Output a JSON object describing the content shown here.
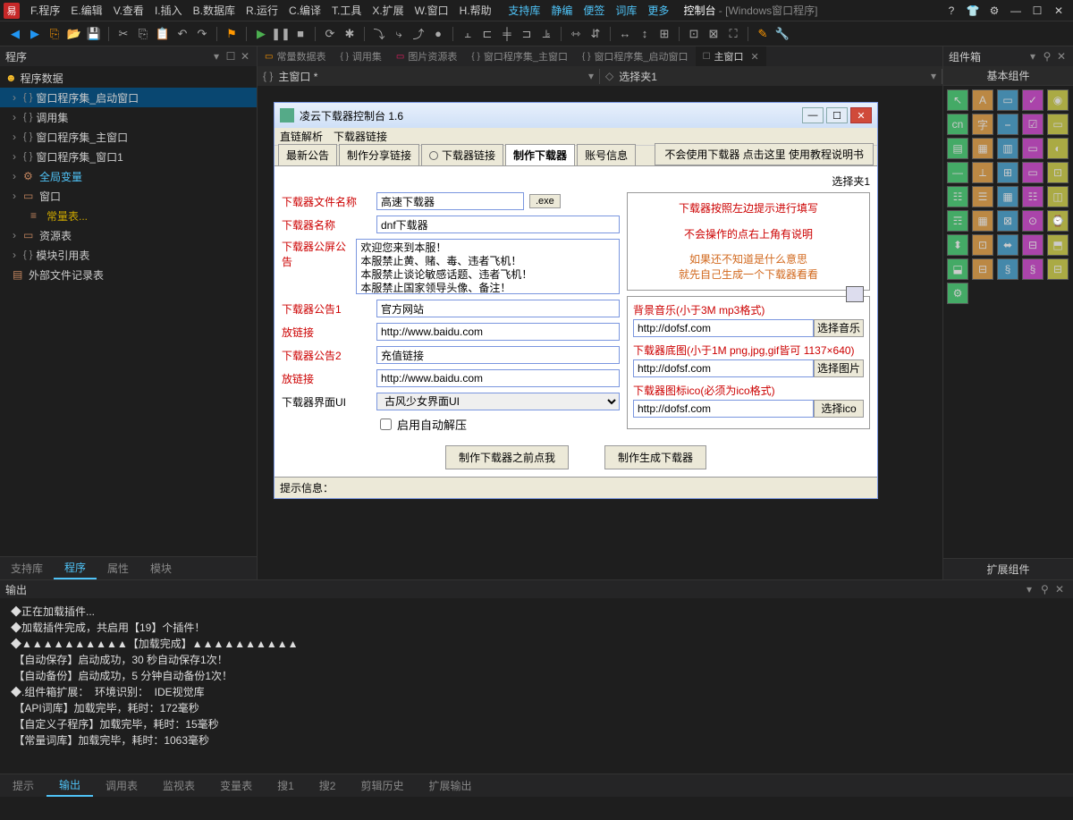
{
  "menubar": {
    "logo": "易",
    "items": [
      "F.程序",
      "E.编辑",
      "V.查看",
      "I.插入",
      "B.数据库",
      "R.运行",
      "C.编译",
      "T.工具",
      "X.扩展",
      "W.窗口",
      "H.帮助"
    ],
    "ext_items": [
      "支持库",
      "静编",
      "便签",
      "词库",
      "更多"
    ],
    "title_main": "控制台",
    "title_sub": " - [Windows窗口程序]"
  },
  "left": {
    "panel_label": "程序",
    "root": "程序数据",
    "items": [
      {
        "label": "窗口程序集_启动窗口",
        "sel": true
      },
      {
        "label": "调用集"
      },
      {
        "label": "窗口程序集_主窗口"
      },
      {
        "label": "窗口程序集_窗口1"
      },
      {
        "label": "全局变量",
        "blue": true,
        "icon": "⚙"
      },
      {
        "label": "窗口",
        "folder": true
      },
      {
        "label": "常量表...",
        "yellow": true,
        "indent": true,
        "icon": "≡"
      },
      {
        "label": "资源表",
        "folder": true,
        "icon": "▦"
      },
      {
        "label": "模块引用表",
        "br": true
      },
      {
        "label": "外部文件记录表",
        "leaf": true,
        "icon": "▤"
      }
    ],
    "tabs": [
      "支持库",
      "程序",
      "属性",
      "模块"
    ],
    "active_tab": 1
  },
  "doc_tabs": [
    {
      "label": "常量数据表",
      "icon": "orange"
    },
    {
      "label": "调用集",
      "icon": "grey"
    },
    {
      "label": "图片资源表",
      "icon": "pink"
    },
    {
      "label": "窗口程序集_主窗口",
      "icon": "grey"
    },
    {
      "label": "窗口程序集_启动窗口",
      "icon": "grey"
    },
    {
      "label": "主窗口",
      "icon": "grey",
      "active": true,
      "close": true
    }
  ],
  "subbar": {
    "left": "主窗口 *",
    "right": "选择夹1"
  },
  "sim": {
    "title": "凌云下载器控制台  1.6",
    "menu": [
      "直链解析",
      "下载器链接"
    ],
    "tabs": [
      "最新公告",
      "制作分享链接",
      "下载器链接",
      "制作下载器",
      "账号信息"
    ],
    "tab_dot_index": 2,
    "active_tab": 3,
    "right_note": "不会使用下载器 点击这里 使用教程说明书",
    "clip_label": "选择夹1",
    "f": {
      "file_label": "下载器文件名称",
      "file_val": "高速下载器",
      "file_ext": ".exe",
      "name_label": "下载器名称",
      "name_val": "dnf下载器",
      "ann_label": "下载器公屏公告",
      "ann_val": "欢迎您来到本服！\n本服禁止黄、赌、毒、违者飞机！\n本服禁止谈论敏感话题、违者飞机！\n本服禁止国家领导头像、备注！\n本服禁止骂人、广告狗和死妈的推广者！",
      "a1_label": "下载器公告1",
      "a1_val": "官方网站",
      "l1_label": "放链接",
      "l1_val": "http://www.baidu.com",
      "a2_label": "下载器公告2",
      "a2_val": "充值链接",
      "l2_label": "放链接",
      "l2_val": "http://www.baidu.com",
      "ui_label": "下载器界面UI",
      "ui_val": "古风少女界面UI",
      "chk_label": "启用自动解压",
      "btn_left": "制作下载器之前点我",
      "btn_right": "制作生成下载器"
    },
    "instruct": {
      "r1": "下载器按照左边提示进行填写",
      "r2": "不会操作的点右上角有说明",
      "r3a": "如果还不知道是什么意思",
      "r3b": "就先自己生成一个下载器看看"
    },
    "media": {
      "m1_lbl": "背景音乐(小于3M  mp3格式)",
      "m1_val": "http://dofsf.com",
      "m1_btn": "选择音乐",
      "m2_lbl": "下载器底图(小于1M  png,jpg,gif皆可  1137×640)",
      "m2_val": "http://dofsf.com",
      "m2_btn": "选择图片",
      "m3_lbl": "下载器图标ico(必须为ico格式)",
      "m3_val": "http://dofsf.com",
      "m3_btn": "选择ico"
    },
    "status_label": "提示信息："
  },
  "right": {
    "panel_label": "组件箱",
    "sub": "基本组件",
    "foot": "扩展组件",
    "cells": [
      "↖",
      "A",
      "▭",
      "✓",
      "◉",
      "cn",
      "字",
      "⎯",
      "☑",
      "▭",
      "▤",
      "▦",
      "▥",
      "▭",
      "◐",
      "—",
      "⟂",
      "⊞",
      "▭",
      "⊡",
      "☷",
      "☰",
      "▦",
      "☷",
      "◫",
      "☶",
      "▦",
      "⊠",
      "⊙",
      "⌚",
      "⬍",
      "⊡",
      "⬌",
      "⊟",
      "⬒",
      "⬓",
      "⊟",
      "§",
      "§",
      "⊟",
      "⚙"
    ]
  },
  "output": {
    "label": "输出",
    "lines": [
      "◆正在加载插件...",
      "◆加载插件完成，共启用【19】个插件！",
      "◆▲▲▲▲▲▲▲▲▲▲【加载完成】▲▲▲▲▲▲▲▲▲▲",
      " 【自动保存】启动成功，30 秒自动保存1次！",
      " 【自动备份】启动成功，5 分钟自动备份1次！",
      "◆.组件箱扩展：  环境识别：  IDE视觉库",
      " 【API词库】加载完毕，耗时：172毫秒",
      " 【自定义子程序】加载完毕，耗时：15毫秒",
      " 【常量词库】加载完毕，耗时：1063毫秒"
    ],
    "tabs": [
      "提示",
      "输出",
      "调用表",
      "监视表",
      "变量表",
      "搜1",
      "搜2",
      "剪辑历史",
      "扩展输出"
    ],
    "active_tab": 1
  }
}
